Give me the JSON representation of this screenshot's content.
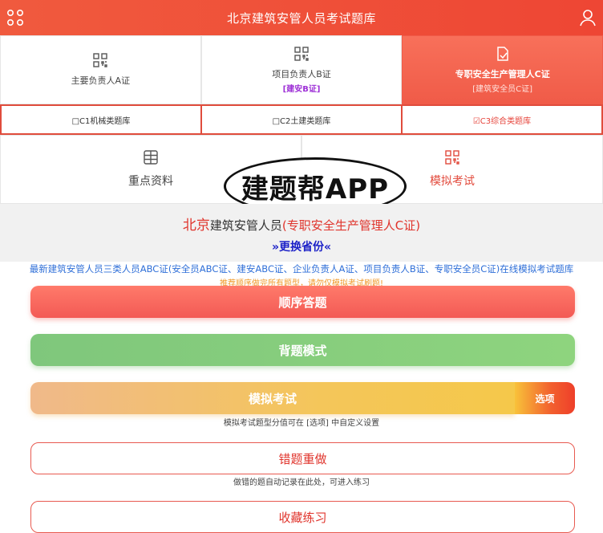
{
  "header": {
    "title": "北京建筑安管人员考试题库"
  },
  "certs": [
    {
      "name": "主要负责人A证",
      "sub": ""
    },
    {
      "name": "项目负责人B证",
      "sub": "[建安B证]"
    },
    {
      "name": "专职安全生产管理人C证",
      "sub": "[建筑安全员C证]"
    }
  ],
  "categories": [
    {
      "label": "□C1机械类题库"
    },
    {
      "label": "□C2土建类题库"
    },
    {
      "label": "☑C3综合类题库"
    }
  ],
  "features": [
    {
      "label": "重点资料"
    },
    {
      "label": "模拟考试"
    }
  ],
  "watermark": "建题帮APP",
  "province": {
    "city": "北京",
    "role": "建筑安管人员",
    "cert": "(专职安全生产管理人C证)",
    "change": "»更换省份«"
  },
  "promo": "最新建筑安管人员三类人员ABC证(安全员ABC证、建安ABC证、企业负责人A证、项目负责人B证、专职安全员C证)在线模拟考试题库",
  "hint": "推荐顺序做完所有题型，请勿仅模拟考试刷题!",
  "buttons": {
    "sequential": "顺序答题",
    "memorize": "背题模式",
    "exam": "模拟考试",
    "options": "选项",
    "exam_note": "模拟考试题型分值可在 [选项] 中自定义设置",
    "wrong": "错题重做",
    "wrong_note": "做错的题自动记录在此处，可进入练习",
    "favorites": "收藏练习"
  },
  "colors": {
    "brand": "#ee4634",
    "active_tab": "#f05b48",
    "memo_green": "#8ed47e",
    "link_blue": "#2f6fd8"
  },
  "icons": {
    "menu": "grid-circles-icon",
    "user": "user-icon",
    "cert": "qr-code-icon",
    "doc": "document-edit-icon",
    "data": "list-grid-icon"
  }
}
